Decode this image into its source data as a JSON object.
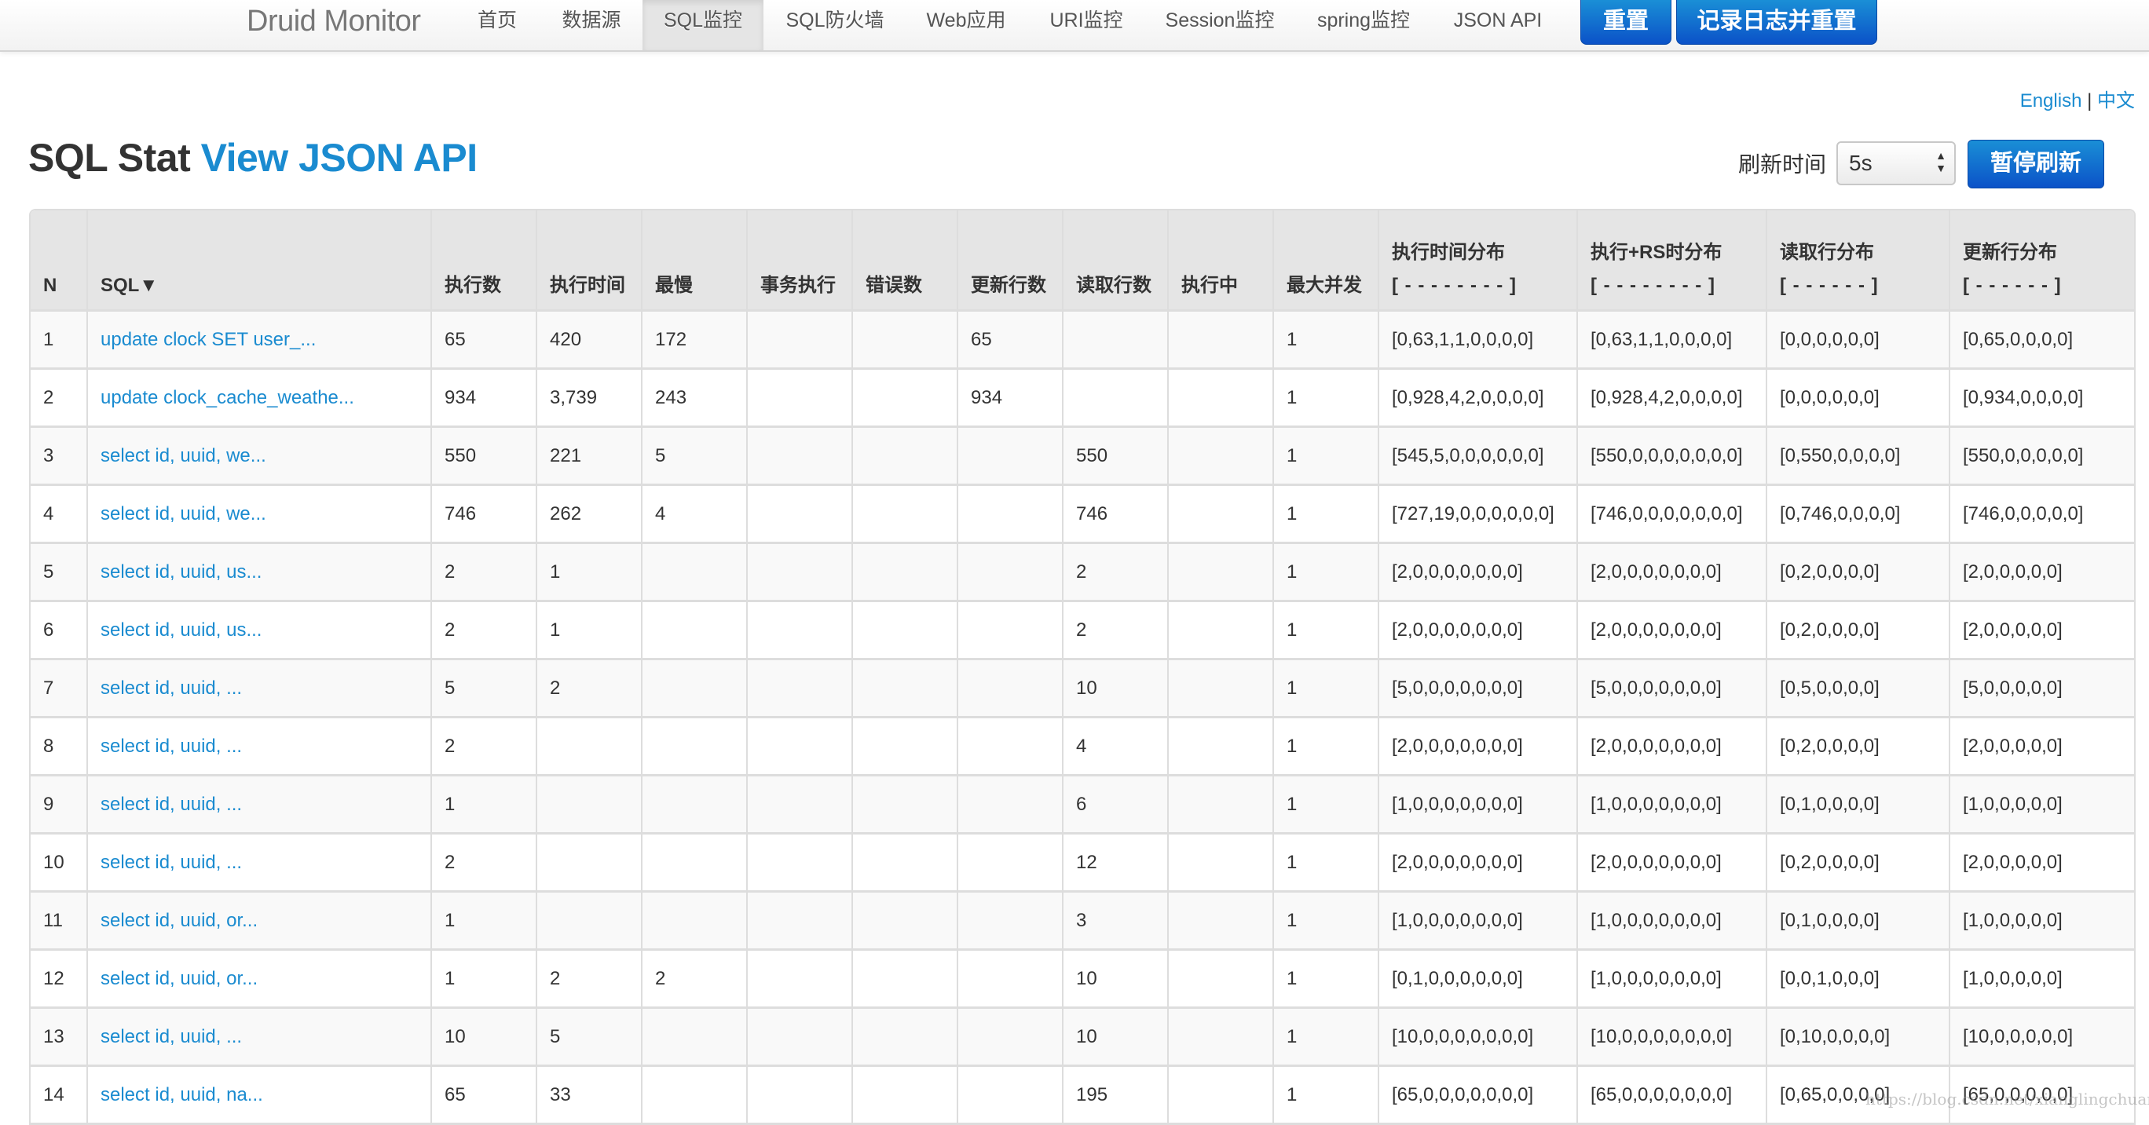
{
  "navbar": {
    "brand": "Druid Monitor",
    "items": [
      {
        "label": "首页",
        "active": false
      },
      {
        "label": "数据源",
        "active": false
      },
      {
        "label": "SQL监控",
        "active": true
      },
      {
        "label": "SQL防火墙",
        "active": false
      },
      {
        "label": "Web应用",
        "active": false
      },
      {
        "label": "URI监控",
        "active": false
      },
      {
        "label": "Session监控",
        "active": false
      },
      {
        "label": "spring监控",
        "active": false
      },
      {
        "label": "JSON API",
        "active": false
      }
    ],
    "reset_button": "重置",
    "log_reset_button": "记录日志并重置"
  },
  "lang": {
    "english": "English",
    "separator": "|",
    "chinese": "中文"
  },
  "title": {
    "prefix": "SQL Stat",
    "link": "View JSON API"
  },
  "refresh": {
    "label": "刷新时间",
    "selected": "5s",
    "pause_button": "暂停刷新"
  },
  "table": {
    "headers": [
      {
        "line1": "",
        "line2": "N"
      },
      {
        "line1": "",
        "line2": "SQL▼"
      },
      {
        "line1": "",
        "line2": "执行数"
      },
      {
        "line1": "",
        "line2": "执行时间"
      },
      {
        "line1": "",
        "line2": "最慢"
      },
      {
        "line1": "",
        "line2": "事务执行"
      },
      {
        "line1": "",
        "line2": "错误数"
      },
      {
        "line1": "",
        "line2": "更新行数"
      },
      {
        "line1": "",
        "line2": "读取行数"
      },
      {
        "line1": "",
        "line2": "执行中"
      },
      {
        "line1": "",
        "line2": "最大并发"
      },
      {
        "line1": "执行时间分布",
        "line2": "[ - - - - - - - - ]"
      },
      {
        "line1": "执行+RS时分布",
        "line2": "[ - - - - - - - - ]"
      },
      {
        "line1": "读取行分布",
        "line2": "[ - - - - - - ]"
      },
      {
        "line1": "更新行分布",
        "line2": "[ - - - - - - ]"
      }
    ],
    "rows": [
      [
        "1",
        "update clock SET user_...",
        "65",
        "420",
        "172",
        "",
        "",
        "65",
        "",
        "",
        "1",
        "[0,63,1,1,0,0,0,0]",
        "[0,63,1,1,0,0,0,0]",
        "[0,0,0,0,0,0]",
        "[0,65,0,0,0,0]"
      ],
      [
        "2",
        "update clock_cache_weathe...",
        "934",
        "3,739",
        "243",
        "",
        "",
        "934",
        "",
        "",
        "1",
        "[0,928,4,2,0,0,0,0]",
        "[0,928,4,2,0,0,0,0]",
        "[0,0,0,0,0,0]",
        "[0,934,0,0,0,0]"
      ],
      [
        "3",
        "select id, uuid, we...",
        "550",
        "221",
        "5",
        "",
        "",
        "",
        "550",
        "",
        "1",
        "[545,5,0,0,0,0,0,0]",
        "[550,0,0,0,0,0,0,0]",
        "[0,550,0,0,0,0]",
        "[550,0,0,0,0,0]"
      ],
      [
        "4",
        "select id, uuid, we...",
        "746",
        "262",
        "4",
        "",
        "",
        "",
        "746",
        "",
        "1",
        "[727,19,0,0,0,0,0,0]",
        "[746,0,0,0,0,0,0,0]",
        "[0,746,0,0,0,0]",
        "[746,0,0,0,0,0]"
      ],
      [
        "5",
        "select id, uuid, us...",
        "2",
        "1",
        "",
        "",
        "",
        "",
        "2",
        "",
        "1",
        "[2,0,0,0,0,0,0,0]",
        "[2,0,0,0,0,0,0,0]",
        "[0,2,0,0,0,0]",
        "[2,0,0,0,0,0]"
      ],
      [
        "6",
        "select id, uuid, us...",
        "2",
        "1",
        "",
        "",
        "",
        "",
        "2",
        "",
        "1",
        "[2,0,0,0,0,0,0,0]",
        "[2,0,0,0,0,0,0,0]",
        "[0,2,0,0,0,0]",
        "[2,0,0,0,0,0]"
      ],
      [
        "7",
        "select id, uuid, ...",
        "5",
        "2",
        "",
        "",
        "",
        "",
        "10",
        "",
        "1",
        "[5,0,0,0,0,0,0,0]",
        "[5,0,0,0,0,0,0,0]",
        "[0,5,0,0,0,0]",
        "[5,0,0,0,0,0]"
      ],
      [
        "8",
        "select id, uuid, ...",
        "2",
        "",
        "",
        "",
        "",
        "",
        "4",
        "",
        "1",
        "[2,0,0,0,0,0,0,0]",
        "[2,0,0,0,0,0,0,0]",
        "[0,2,0,0,0,0]",
        "[2,0,0,0,0,0]"
      ],
      [
        "9",
        "select id, uuid, ...",
        "1",
        "",
        "",
        "",
        "",
        "",
        "6",
        "",
        "1",
        "[1,0,0,0,0,0,0,0]",
        "[1,0,0,0,0,0,0,0]",
        "[0,1,0,0,0,0]",
        "[1,0,0,0,0,0]"
      ],
      [
        "10",
        "select id, uuid, ...",
        "2",
        "",
        "",
        "",
        "",
        "",
        "12",
        "",
        "1",
        "[2,0,0,0,0,0,0,0]",
        "[2,0,0,0,0,0,0,0]",
        "[0,2,0,0,0,0]",
        "[2,0,0,0,0,0]"
      ],
      [
        "11",
        "select id, uuid, or...",
        "1",
        "",
        "",
        "",
        "",
        "",
        "3",
        "",
        "1",
        "[1,0,0,0,0,0,0,0]",
        "[1,0,0,0,0,0,0,0]",
        "[0,1,0,0,0,0]",
        "[1,0,0,0,0,0]"
      ],
      [
        "12",
        "select id, uuid, or...",
        "1",
        "2",
        "2",
        "",
        "",
        "",
        "10",
        "",
        "1",
        "[0,1,0,0,0,0,0,0]",
        "[1,0,0,0,0,0,0,0]",
        "[0,0,1,0,0,0]",
        "[1,0,0,0,0,0]"
      ],
      [
        "13",
        "select id, uuid, ...",
        "10",
        "5",
        "",
        "",
        "",
        "",
        "10",
        "",
        "1",
        "[10,0,0,0,0,0,0,0]",
        "[10,0,0,0,0,0,0,0]",
        "[0,10,0,0,0,0]",
        "[10,0,0,0,0,0]"
      ],
      [
        "14",
        "select id, uuid, na...",
        "65",
        "33",
        "",
        "",
        "",
        "",
        "195",
        "",
        "1",
        "[65,0,0,0,0,0,0,0]",
        "[65,0,0,0,0,0,0,0]",
        "[0,65,0,0,0,0]",
        "[65,0,0,0,0,0]"
      ]
    ]
  },
  "watermark": "https://blog.csdn.net/xianglingchuan",
  "colors": {
    "accent": "#1a8bd0",
    "button_top": "#1a8fd6",
    "button_bottom": "#0b52c8",
    "header_bg": "#e5e5e5"
  }
}
